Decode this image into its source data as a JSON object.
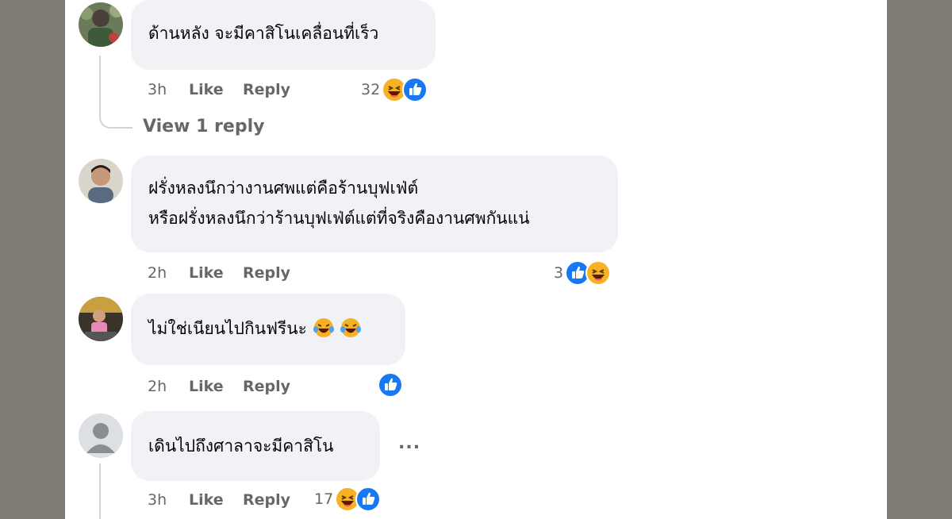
{
  "comments": [
    {
      "text_lines": [
        "ด้านหลัง จะมีคาสิโนเคลื่อนที่เร็ว"
      ],
      "time": "3h",
      "like": "Like",
      "reply": "Reply",
      "reaction_count": "32",
      "reactions": [
        "haha-icon",
        "like-icon"
      ],
      "view_replies": "View 1 reply"
    },
    {
      "text_lines": [
        "ฝรั่งหลงนึกว่างานศพแต่คือร้านบุฟเฟ่ต์",
        "หรือฝรั่งหลงนึกว่าร้านบุฟเฟ่ต์แต่ที่จริงคืองานศพกันแน่"
      ],
      "time": "2h",
      "like": "Like",
      "reply": "Reply",
      "reaction_count": "3",
      "reactions": [
        "like-icon",
        "haha-icon"
      ]
    },
    {
      "text_lines": [
        "ไม่ใช่เนียนไปกินฟรีนะ"
      ],
      "text_emojis": [
        "rofl-emoji",
        "rofl-emoji"
      ],
      "time": "2h",
      "like": "Like",
      "reply": "Reply",
      "reaction_count": "",
      "reactions": [
        "like-icon"
      ]
    },
    {
      "text_lines": [
        "เดินไปถึงศาลาจะมีคาสิโน"
      ],
      "time": "3h",
      "like": "Like",
      "reply": "Reply",
      "reaction_count": "17",
      "reactions": [
        "haha-icon",
        "like-icon"
      ],
      "more_label": "..."
    }
  ],
  "colors": {
    "bubble": "#f0f2f5",
    "meta_text": "#65676b",
    "like_blue": "#1877f2",
    "haha_yellow": "#f7b125",
    "page_frame": "#7d7b72"
  }
}
